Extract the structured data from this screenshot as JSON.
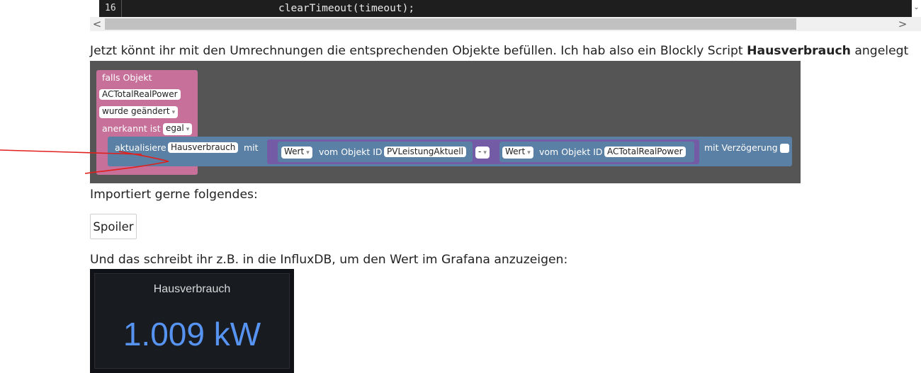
{
  "code": {
    "line_number": "16",
    "line_text": "clearTimeout(timeout);"
  },
  "scroll": {
    "left_arrow": "<",
    "right_arrow": ">",
    "dropdown": "⌄"
  },
  "post": {
    "para1_text": "Jetzt könnt ihr mit den Umrechnungen die entsprechenden Objekte befüllen. Ich hab also ein Blockly Script ",
    "para1_bold": "Hausverbrauch",
    "para1_end": " angelegt",
    "para2": "Importiert gerne folgendes:",
    "spoiler_label": "Spoiler",
    "para3": "Und das schreibt ihr z.B. in die InfluxDB, um den Wert im Grafana anzuzeigen:"
  },
  "blockly": {
    "if_object": "falls Objekt",
    "object_id": "ACTotalRealPower",
    "changed": "wurde geändert",
    "acknowledged": "anerkannt ist",
    "ack_value": "egal",
    "update": "aktualisiere",
    "update_target": "Hausverbrauch",
    "with": "mit",
    "value_label": "Wert",
    "from_object": "vom Objekt ID",
    "object_a": "PVLeistungAktuell",
    "operator": "-",
    "object_b": "ACTotalRealPower",
    "delay": "mit Verzögerung",
    "dropdown_arrow": "▾"
  },
  "grafana": {
    "title": "Hausverbrauch",
    "value": "1.009 kW"
  },
  "colors": {
    "event_block": "#c7709a",
    "update_block": "#5b80a5",
    "math_block": "#745ba5",
    "grafana_value": "#5794f2",
    "annotation": "#e0201c"
  }
}
